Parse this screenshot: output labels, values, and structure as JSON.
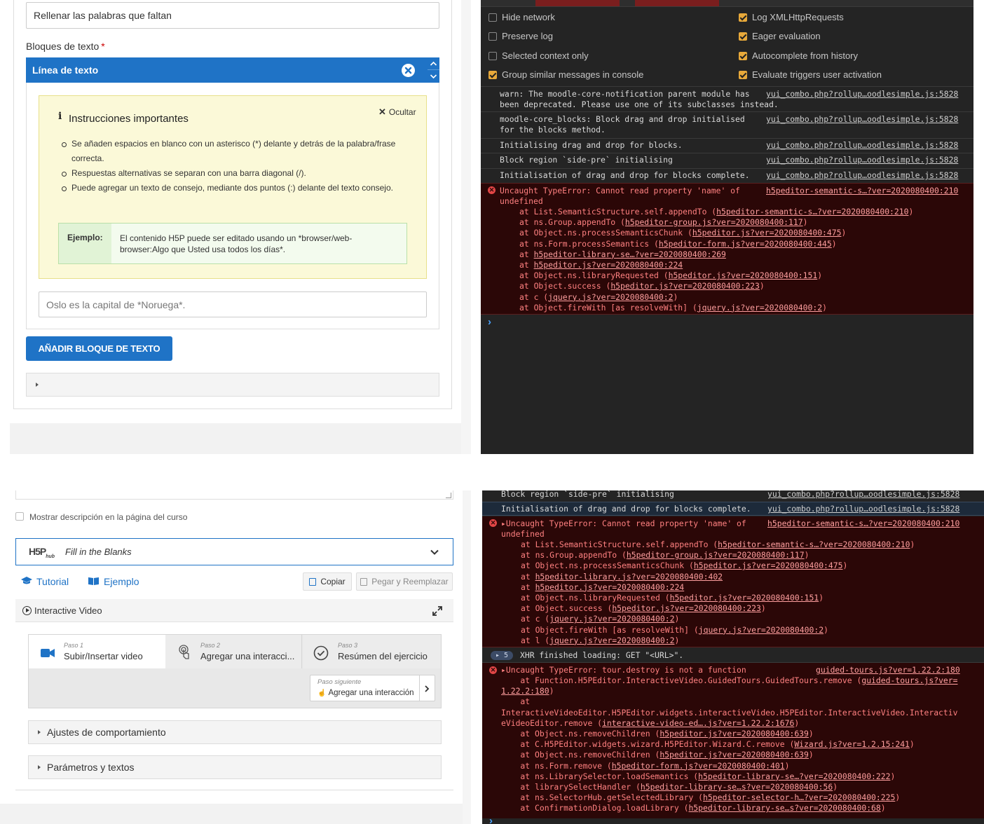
{
  "top_editor": {
    "title_value": "Rellenar las palabras que faltan",
    "blocks_label": "Bloques de texto",
    "required_mark": "*",
    "text_line_label": "Línea de texto",
    "hide_label": "Ocultar",
    "instructions_title": "Instrucciones importantes",
    "instructions": [
      "Se añaden espacios en blanco con un asterisco (*) delante y detrás de la palabra/frase correcta.",
      "Respuestas alternativas se separan con una barra diagonal (/).",
      "Puede agregar un texto de consejo, mediante dos puntos (:) delante del texto consejo."
    ],
    "example_label": "Ejemplo:",
    "example_text": "El contenido H5P puede ser editado usando un *browser/web-browser:Algo que Usted usa todos los días*.",
    "text_placeholder": "Oslo es la capital de *Noruega*.",
    "add_button": "AÑADIR BLOQUE DE TEXTO"
  },
  "top_console": {
    "settings_left": [
      {
        "label": "Hide network",
        "checked": false
      },
      {
        "label": "Preserve log",
        "checked": false
      },
      {
        "label": "Selected context only",
        "checked": false
      },
      {
        "label": "Group similar messages in console",
        "checked": true
      }
    ],
    "settings_right": [
      {
        "label": "Log XMLHttpRequests",
        "checked": true
      },
      {
        "label": "Eager evaluation",
        "checked": true
      },
      {
        "label": "Autocomplete from history",
        "checked": true
      },
      {
        "label": "Evaluate triggers user activation",
        "checked": true
      }
    ],
    "messages": [
      {
        "text": "warn: The moodle-core-notification parent module has\nbeen deprecated. Please use one of its subclasses instead.",
        "source": "yui_combo.php?rollup…oodlesimple.js:5828"
      },
      {
        "text": "moodle-core_blocks: Block drag and drop initialised\nfor the blocks method.",
        "source": "yui_combo.php?rollup…oodlesimple.js:5828"
      },
      {
        "text": "Initialising drag and drop for blocks.",
        "source": "yui_combo.php?rollup…oodlesimple.js:5828"
      },
      {
        "text": "Block region `side-pre` initialising",
        "source": "yui_combo.php?rollup…oodlesimple.js:5828"
      },
      {
        "text": "Initialisation of drag and drop for blocks complete.",
        "source": "yui_combo.php?rollup…oodlesimple.js:5828"
      }
    ],
    "error": {
      "text": "Uncaught TypeError: Cannot read property 'name' of\nundefined",
      "source": "h5peditor-semantic-s…?ver=2020080400:210",
      "stack": [
        [
          "at List.SemanticStructure.self.appendTo (",
          "h5peditor-semantic-s…?ver=2020080400:210",
          ")"
        ],
        [
          "at ns.Group.appendTo (",
          "h5peditor-group.js?ver=2020080400:117",
          ")"
        ],
        [
          "at Object.ns.processSemanticsChunk (",
          "h5peditor.js?ver=2020080400:475",
          ")"
        ],
        [
          "at ns.Form.processSemantics (",
          "h5peditor-form.js?ver=2020080400:445",
          ")"
        ],
        [
          "at ",
          "h5peditor-library-se…?ver=2020080400:269",
          ""
        ],
        [
          "at ",
          "h5peditor.js?ver=2020080400:224",
          ""
        ],
        [
          "at Object.ns.libraryRequested (",
          "h5peditor.js?ver=2020080400:151",
          ")"
        ],
        [
          "at Object.success (",
          "h5peditor.js?ver=2020080400:223",
          ")"
        ],
        [
          "at c (",
          "jquery.js?ver=2020080400:2",
          ")"
        ],
        [
          "at Object.fireWith [as resolveWith] (",
          "jquery.js?ver=2020080400:2",
          ")"
        ]
      ]
    },
    "prompt": "›"
  },
  "bottom_editor": {
    "show_description": "Mostrar descripción en la página del curso",
    "hub_logo": "H5P",
    "hub_logo_sub": "hub",
    "hub_title": "Fill in the Blanks",
    "tutorial": "Tutorial",
    "example": "Ejemplo",
    "copy": "Copiar",
    "paste": "Pegar y Reemplazar",
    "iv_title": "Interactive Video",
    "steps": [
      {
        "small": "Paso 1",
        "big": "Subir/Insertar video"
      },
      {
        "small": "Paso 2",
        "big": "Agregar una interacci..."
      },
      {
        "small": "Paso 3",
        "big": "Resúmen del ejercicio"
      }
    ],
    "next_small": "Paso siguiente",
    "next_big": "Agregar una interacción",
    "behaviour": "Ajustes de comportamiento",
    "params": "Parámetros y textos"
  },
  "bottom_console": {
    "messages": [
      {
        "text": "Block region `side-pre` initialising",
        "source": "yui_combo.php?rollup…oodlesimple.js:5828"
      },
      {
        "text": "Initialisation of drag and drop for blocks complete.",
        "source": "yui_combo.php?rollup…oodlesimple.js:5828"
      }
    ],
    "error1": {
      "text": "▸Uncaught TypeError: Cannot read property 'name' of\nundefined",
      "source": "h5peditor-semantic-s…?ver=2020080400:210",
      "stack": [
        [
          "at List.SemanticStructure.self.appendTo (",
          "h5peditor-semantic-s…?ver=2020080400:210",
          ")"
        ],
        [
          "at ns.Group.appendTo (",
          "h5peditor-group.js?ver=2020080400:117",
          ")"
        ],
        [
          "at Object.ns.processSemanticsChunk (",
          "h5peditor.js?ver=2020080400:475",
          ")"
        ],
        [
          "at ",
          "h5peditor-library.js?ver=2020080400:402",
          ""
        ],
        [
          "at ",
          "h5peditor.js?ver=2020080400:224",
          ""
        ],
        [
          "at Object.ns.libraryRequested (",
          "h5peditor.js?ver=2020080400:151",
          ")"
        ],
        [
          "at Object.success (",
          "h5peditor.js?ver=2020080400:223",
          ")"
        ],
        [
          "at c (",
          "jquery.js?ver=2020080400:2",
          ")"
        ],
        [
          "at Object.fireWith [as resolveWith] (",
          "jquery.js?ver=2020080400:2",
          ")"
        ],
        [
          "at l (",
          "jquery.js?ver=2020080400:2",
          ")"
        ]
      ]
    },
    "xhr_count": "5",
    "xhr_text": "XHR finished loading: GET \"<URL>\".",
    "error2": {
      "text": "▸Uncaught TypeError: tour.destroy is not a function",
      "source": "guided-tours.js?ver=1.22.2:180",
      "lines": [
        {
          "pre": "    at Function.H5PEditor.InteractiveVideo.GuidedTours.GuidedTours.remove (",
          "link": "guided-tours.js?ver=",
          "post": ""
        },
        {
          "pre": "",
          "link": "1.22.2:180",
          "post": ")"
        },
        {
          "pre": "    at",
          "link": "",
          "post": ""
        },
        {
          "pre": "InteractiveVideoEditor.H5PEditor.widgets.interactiveVideo.H5PEditor.InteractiveVideo.Interactiv",
          "link": "",
          "post": ""
        },
        {
          "pre": "eVideoEditor.remove (",
          "link": "interactive-video-ed….js?ver=1.22.2:1676",
          "post": ")"
        },
        {
          "pre": "    at Object.ns.removeChildren (",
          "link": "h5peditor.js?ver=2020080400:639",
          "post": ")"
        },
        {
          "pre": "    at C.H5PEditor.widgets.wizard.H5PEditor.Wizard.C.remove (",
          "link": "Wizard.js?ver=1.2.15:241",
          "post": ")"
        },
        {
          "pre": "    at Object.ns.removeChildren (",
          "link": "h5peditor.js?ver=2020080400:639",
          "post": ")"
        },
        {
          "pre": "    at ns.Form.remove (",
          "link": "h5peditor-form.js?ver=2020080400:401",
          "post": ")"
        },
        {
          "pre": "    at ns.LibrarySelector.loadSemantics (",
          "link": "h5peditor-library-se…?ver=2020080400:222",
          "post": ")"
        },
        {
          "pre": "    at librarySelectHandler (",
          "link": "h5peditor-library-se…s?ver=2020080400:56",
          "post": ")"
        },
        {
          "pre": "    at ns.SelectorHub.getSelectedLibrary (",
          "link": "h5peditor-selector-h…?ver=2020080400:225",
          "post": ")"
        },
        {
          "pre": "    at ConfirmationDialog.loadLibrary (",
          "link": "h5peditor-library-se…s?ver=2020080400:68",
          "post": ")"
        }
      ]
    },
    "prompt": "›"
  }
}
